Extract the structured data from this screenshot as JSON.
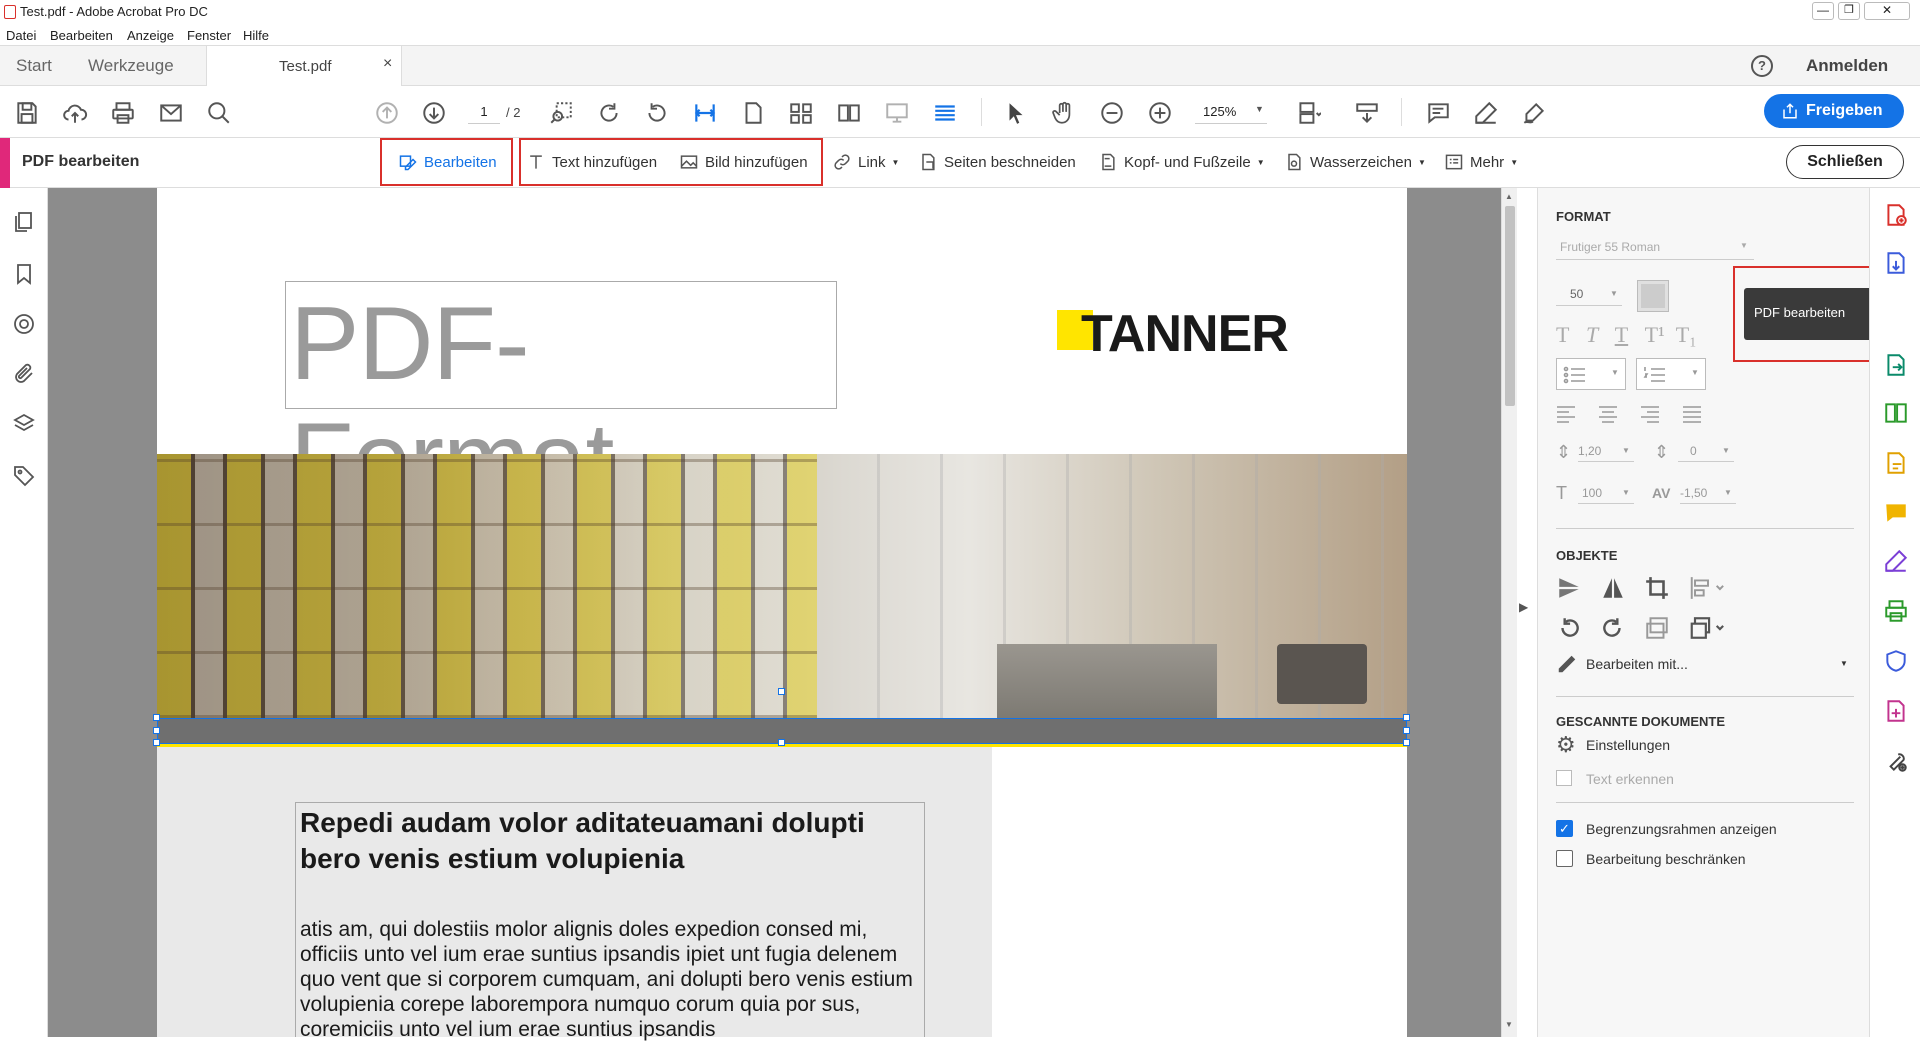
{
  "window": {
    "title": "Test.pdf - Adobe Acrobat Pro DC"
  },
  "menu": [
    "Datei",
    "Bearbeiten",
    "Anzeige",
    "Fenster",
    "Hilfe"
  ],
  "tabs": {
    "start": "Start",
    "tools": "Werkzeuge",
    "doc": "Test.pdf",
    "close": "×"
  },
  "account": {
    "help": "?",
    "signin": "Anmelden"
  },
  "toolbar": {
    "page_current": "1",
    "page_total": "/ 2",
    "zoom": "125%",
    "share": "Freigeben"
  },
  "editbar": {
    "title": "PDF bearbeiten",
    "edit": "Bearbeiten",
    "add_text": "Text hinzufügen",
    "add_image": "Bild hinzufügen",
    "link": "Link",
    "crop": "Seiten beschneiden",
    "header_footer": "Kopf- und Fußzeile",
    "watermark": "Wasserzeichen",
    "more": "Mehr",
    "close": "Schließen"
  },
  "page": {
    "heading": "PDF-Format",
    "logo": "TANNER",
    "article_title": "Repedi audam volor aditateuamani dolupti bero venis estium volupienia",
    "article_body": "atis am, qui dolestiis molor alignis doles expedion consed mi, officiis unto vel ium erae suntius ipsandis ipiet unt fugia delenem quo vent que si corporem cumquam, ani dolupti bero venis estium volupienia corepe laborempora numquo corum quia por sus, coremiciis unto vel ium erae suntius ipsandis"
  },
  "format_panel": {
    "heading": "FORMAT",
    "font": "Frutiger 55 Roman",
    "size": "50",
    "line_spacing": "1,20",
    "para_spacing": "0",
    "scale": "100",
    "tracking": "-1,50",
    "objects_heading": "OBJEKTE",
    "edit_with": "Bearbeiten mit...",
    "scanned_heading": "GESCANNTE DOKUMENTE",
    "settings": "Einstellungen",
    "recognize": "Text erkennen",
    "show_bounds": "Begrenzungsrahmen anzeigen",
    "restrict": "Bearbeitung beschränken"
  },
  "tooltip": {
    "text": "PDF bearbeiten"
  },
  "colors": {
    "accent": "#1473e6",
    "red": "#d9302b",
    "edit_pink": "#e0287a",
    "logo_yellow": "#ffe500"
  }
}
